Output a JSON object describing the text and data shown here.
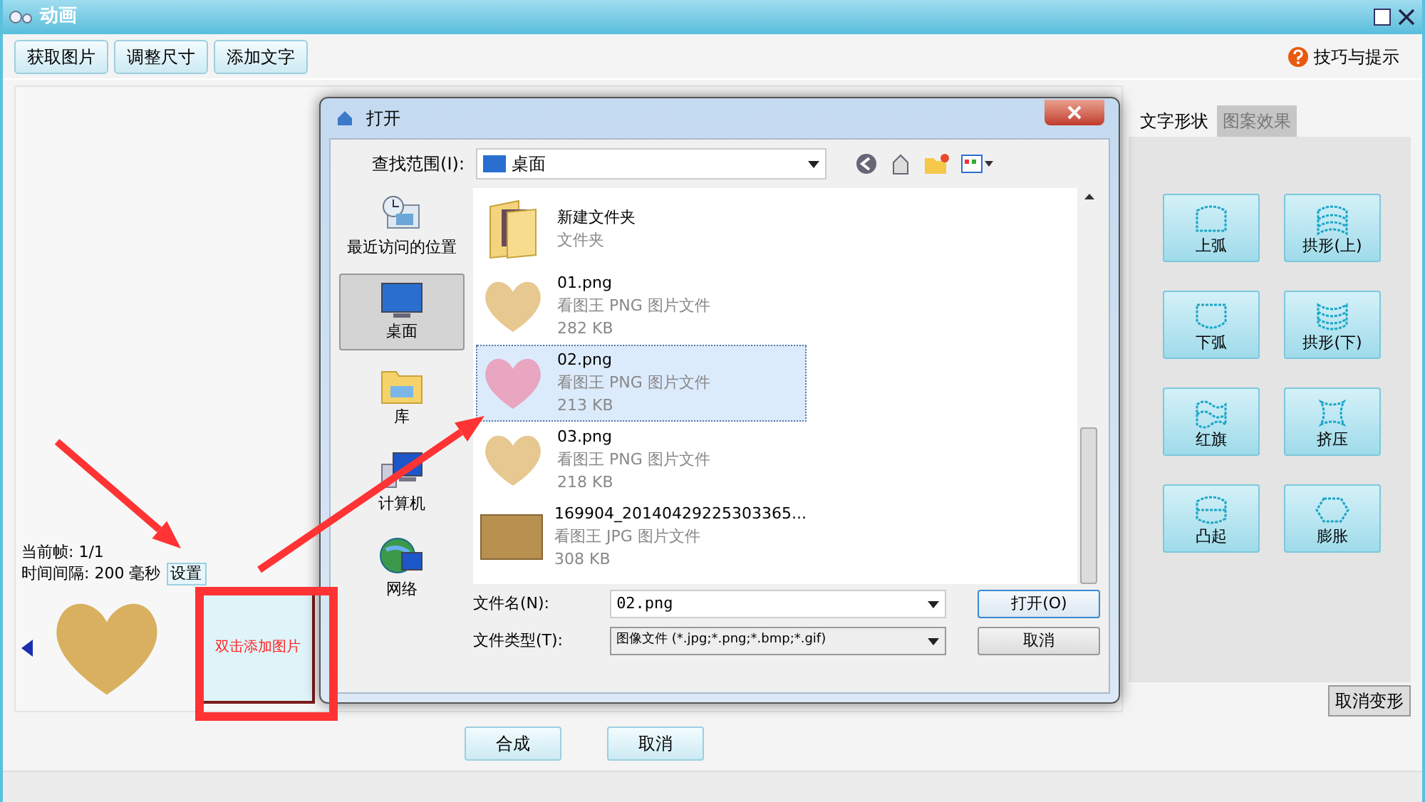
{
  "window": {
    "title": "动画"
  },
  "toolbar": {
    "buttons": [
      "获取图片",
      "调整尺寸",
      "添加文字"
    ],
    "help": "技巧与提示"
  },
  "frames": {
    "current_label": "当前帧:",
    "current_value": "1/1",
    "interval_label": "时间间隔:",
    "interval_value": "200",
    "interval_unit": "毫秒",
    "set_button": "设置",
    "add_hint": "双击添加图片"
  },
  "shape_panel": {
    "tabs": [
      {
        "label": "文字形状",
        "selected": true
      },
      {
        "label": "图案效果",
        "selected": false
      }
    ],
    "shapes": [
      {
        "label": "上弧",
        "kind": "arc-up"
      },
      {
        "label": "拱形(上)",
        "kind": "arch-up"
      },
      {
        "label": "下弧",
        "kind": "arc-down"
      },
      {
        "label": "拱形(下)",
        "kind": "arch-down"
      },
      {
        "label": "红旗",
        "kind": "flag"
      },
      {
        "label": "挤压",
        "kind": "squeeze"
      },
      {
        "label": "凸起",
        "kind": "bulge"
      },
      {
        "label": "膨胀",
        "kind": "inflate"
      }
    ],
    "cancel_button": "取消变形"
  },
  "bottom_buttons": [
    "合成",
    "取消"
  ],
  "dialog": {
    "title": "打开",
    "look_in_label": "查找范围(I):",
    "look_in_value": "桌面",
    "places": [
      {
        "label": "最近访问的位置",
        "kind": "recent",
        "selected": false
      },
      {
        "label": "桌面",
        "kind": "desktop",
        "selected": true
      },
      {
        "label": "库",
        "kind": "library",
        "selected": false
      },
      {
        "label": "计算机",
        "kind": "computer",
        "selected": false
      },
      {
        "label": "网络",
        "kind": "network",
        "selected": false
      }
    ],
    "files": [
      {
        "name": "新建文件夹",
        "type": "文件夹",
        "kind": "folder",
        "selected": false
      },
      {
        "name": "01.png",
        "type": "看图王 PNG 图片文件",
        "size": "282 KB",
        "kind": "heart",
        "selected": false
      },
      {
        "name": "02.png",
        "type": "看图王 PNG 图片文件",
        "size": "213 KB",
        "kind": "heart",
        "selected": true
      },
      {
        "name": "03.png",
        "type": "看图王 PNG 图片文件",
        "size": "218 KB",
        "kind": "heart",
        "selected": false
      },
      {
        "name": "169904_20140429225303365...",
        "type": "看图王 JPG 图片文件",
        "size": "308 KB",
        "kind": "photo",
        "selected": false
      }
    ],
    "filename_label": "文件名(N):",
    "filename_value": "02.png",
    "filetype_label": "文件类型(T):",
    "filetype_value": "图像文件 (*.jpg;*.png;*.bmp;*.gif)",
    "open_button": "打开(O)",
    "cancel_button": "取消"
  }
}
